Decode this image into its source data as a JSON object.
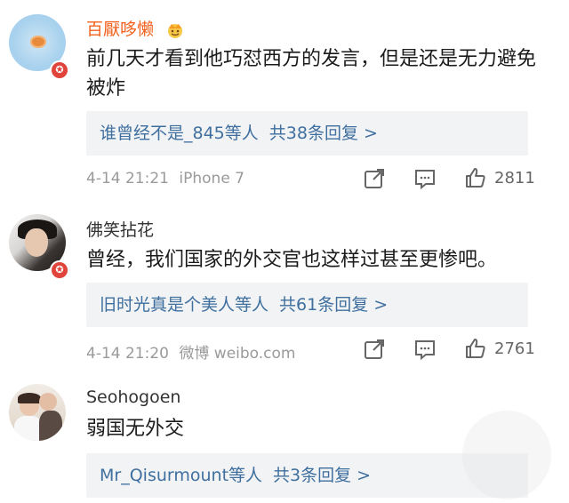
{
  "comments": [
    {
      "username": "百厭哆懒",
      "text": "前几天才看到他巧怼西方的发言，但是还是无力避免被炸",
      "reply_preview": "谁曾经不是_845等人",
      "reply_count": "共38条回复 >",
      "time": "4-14 21:21",
      "device": "iPhone 7",
      "likes": "2811",
      "badge": "✪"
    },
    {
      "username": "佛笑拈花",
      "text": "曾经，我们国家的外交官也这样过甚至更惨吧。",
      "reply_preview": "旧时光真是个美人等人",
      "reply_count": "共61条回复 >",
      "time": "4-14 21:20",
      "device": "微博 weibo.com",
      "likes": "2761",
      "badge": "✪"
    },
    {
      "username": "Seohogoen",
      "text": "弱国无外交",
      "reply_preview": "Mr_Qisurmount等人",
      "reply_count": "共3条回复 >"
    }
  ],
  "colors": {
    "vip_name": "#f2611d",
    "link": "#3f6f9e",
    "reply_bg": "#f2f3f5",
    "meta": "#9a9a9a"
  }
}
